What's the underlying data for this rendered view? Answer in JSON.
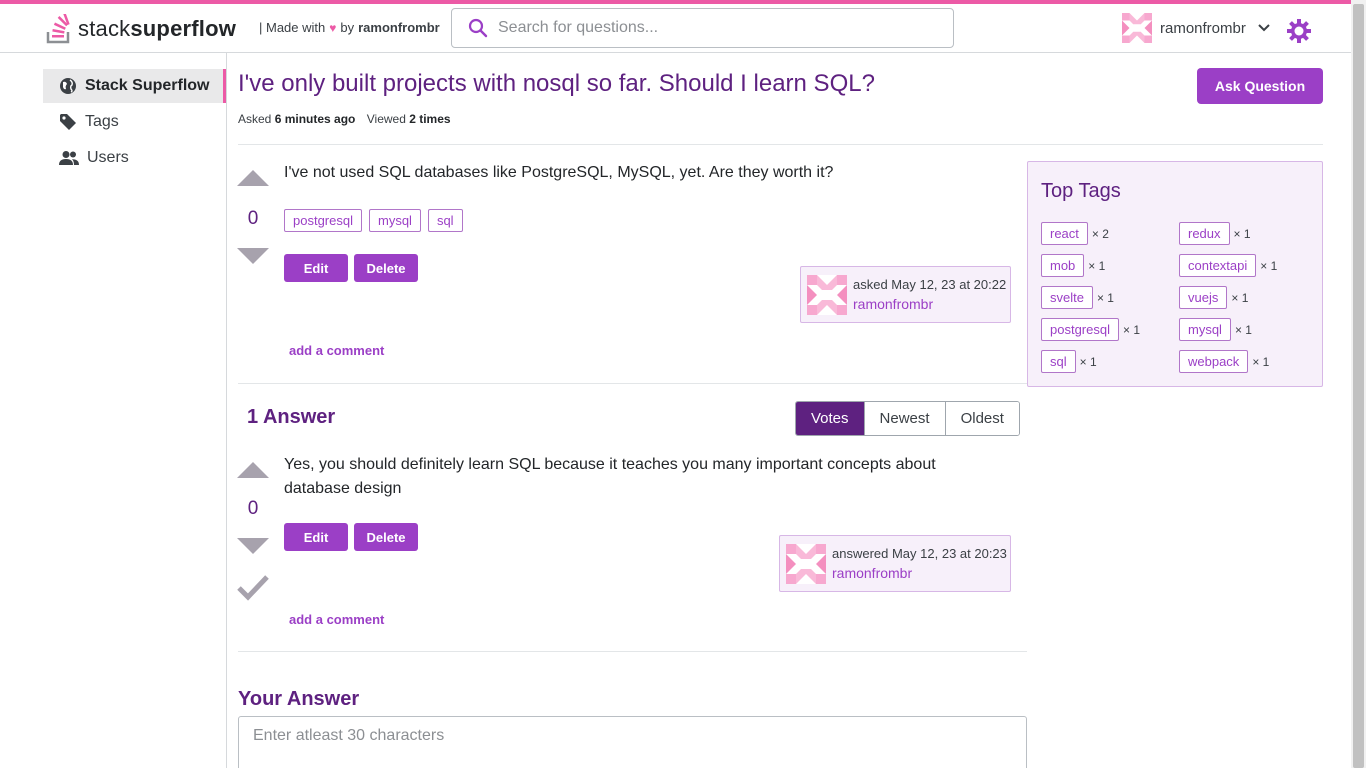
{
  "header": {
    "logo_light": "stack",
    "logo_bold": "superflow",
    "made_prefix": "| Made with",
    "heart": "♥",
    "made_by": "by",
    "made_author": "ramonfrombr",
    "search_placeholder": "Search for questions...",
    "username": "ramonfrombr",
    "icons": {
      "search": "search-icon",
      "user_menu": "chevron-down-icon",
      "theme": "gear-icon"
    }
  },
  "sidebar": {
    "items": [
      {
        "label": "Stack Superflow",
        "icon": "globe-icon",
        "active": true
      },
      {
        "label": "Tags",
        "icon": "tag-icon",
        "active": false
      },
      {
        "label": "Users",
        "icon": "users-icon",
        "active": false
      }
    ]
  },
  "question": {
    "title": "I've only built projects with nosql so far. Should I learn SQL?",
    "ask_button": "Ask Question",
    "asked_label": "Asked",
    "asked_value": "6 minutes ago",
    "viewed_label": "Viewed",
    "viewed_value": "2 times",
    "body": "I've not used SQL databases like PostgreSQL, MySQL, yet. Are they worth it?",
    "votes": "0",
    "tags": [
      "postgresql",
      "mysql",
      "sql"
    ],
    "edit_label": "Edit",
    "delete_label": "Delete",
    "card_when": "asked May 12, 23 at 20:22",
    "card_user": "ramonfrombr",
    "comment_link": "add a comment"
  },
  "answers": {
    "count_label": "1 Answer",
    "sort": [
      {
        "label": "Votes",
        "active": true
      },
      {
        "label": "Newest",
        "active": false
      },
      {
        "label": "Oldest",
        "active": false
      }
    ],
    "items": [
      {
        "body": "Yes, you should definitely learn SQL because it teaches you many important concepts about database design",
        "votes": "0",
        "edit_label": "Edit",
        "delete_label": "Delete",
        "card_when": "answered May 12, 23 at 20:23",
        "card_user": "ramonfrombr",
        "comment_link": "add a comment"
      }
    ]
  },
  "your_answer": {
    "title": "Your Answer",
    "placeholder": "Enter atleast 30 characters"
  },
  "top_tags": {
    "title": "Top Tags",
    "items": [
      {
        "name": "react",
        "count": "× 2"
      },
      {
        "name": "redux",
        "count": "× 1"
      },
      {
        "name": "mob",
        "count": "× 1"
      },
      {
        "name": "contextapi",
        "count": "× 1"
      },
      {
        "name": "svelte",
        "count": "× 1"
      },
      {
        "name": "vuejs",
        "count": "× 1"
      },
      {
        "name": "postgresql",
        "count": "× 1"
      },
      {
        "name": "mysql",
        "count": "× 1"
      },
      {
        "name": "sql",
        "count": "× 1"
      },
      {
        "name": "webpack",
        "count": "× 1"
      }
    ]
  },
  "colors": {
    "accent": "#ec5aa6",
    "primary": "#9b3fc6",
    "primary_dark": "#5e2180",
    "vote_arrow": "#a7a2ad"
  }
}
